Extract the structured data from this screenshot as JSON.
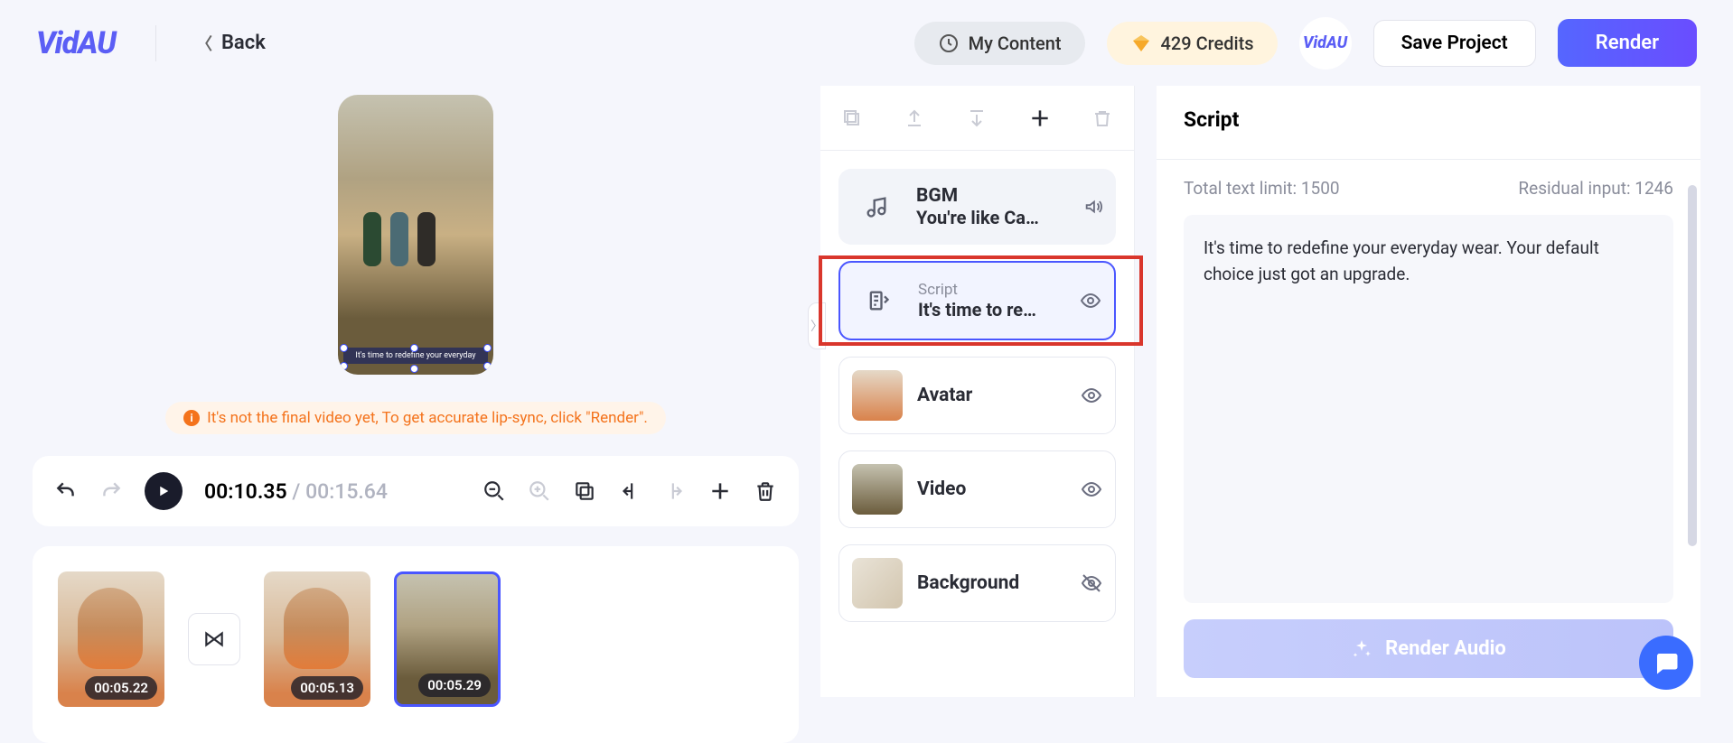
{
  "header": {
    "logo_text": "VidAU",
    "back_label": "Back",
    "my_content_label": "My Content",
    "credits_label": "429 Credits",
    "save_label": "Save Project",
    "render_label": "Render",
    "small_logo": "VidAU"
  },
  "preview": {
    "caption": "It's time to redefine your everyday",
    "warning": "It's not the final video yet, To get accurate lip-sync, click \"Render\"."
  },
  "toolbar": {
    "current_time": "00:10.35",
    "duration": "00:15.64"
  },
  "clips": [
    {
      "duration": "00:05.22"
    },
    {
      "duration": "00:05.13"
    },
    {
      "duration": "00:05.29"
    }
  ],
  "layers": {
    "bgm": {
      "label": "BGM",
      "value": "You're like Ca…"
    },
    "script": {
      "label": "Script",
      "value": "It's time to re…"
    },
    "avatar": {
      "label": "Avatar"
    },
    "video": {
      "label": "Video"
    },
    "background": {
      "label": "Background"
    }
  },
  "script_panel": {
    "title": "Script",
    "total_limit_label": "Total text limit: 1500",
    "residual_label": "Residual input: 1246",
    "content": "It's time to redefine your everyday wear. Your default choice just got an upgrade.",
    "render_audio_label": "Render Audio"
  }
}
